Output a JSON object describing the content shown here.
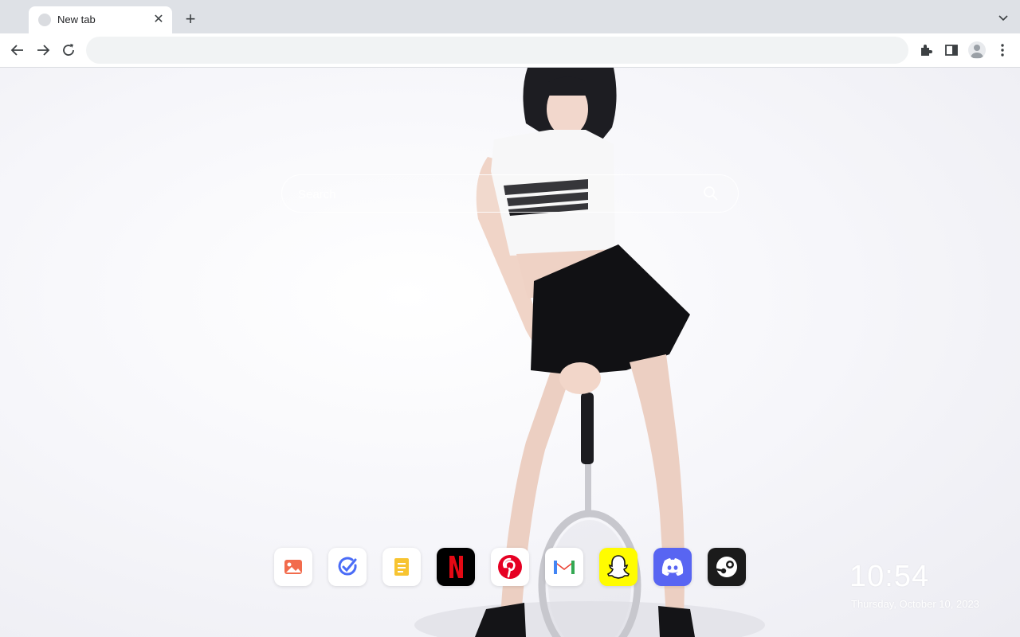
{
  "browser": {
    "tab": {
      "title": "New tab"
    },
    "omnibox": {
      "value": ""
    }
  },
  "page": {
    "search": {
      "placeholder": "Search"
    },
    "dock": [
      {
        "name": "gallery-app",
        "icon": "image-icon"
      },
      {
        "name": "todo-app",
        "icon": "check-icon"
      },
      {
        "name": "notes-app",
        "icon": "notes-icon"
      },
      {
        "name": "netflix-app",
        "icon": "netflix-icon"
      },
      {
        "name": "pinterest-app",
        "icon": "pinterest-icon"
      },
      {
        "name": "gmail-app",
        "icon": "gmail-icon"
      },
      {
        "name": "snapchat-app",
        "icon": "snapchat-icon"
      },
      {
        "name": "discord-app",
        "icon": "discord-icon"
      },
      {
        "name": "steam-app",
        "icon": "steam-icon"
      }
    ],
    "clock": {
      "time": "10:54",
      "date": "Thursday, October 10, 2023"
    }
  },
  "colors": {
    "tabstrip": "#dee1e6",
    "netflix": "#e50914",
    "pinterest": "#e60023",
    "snapchat": "#fffc00",
    "discord": "#5865f2",
    "steam": "#1b1b1b"
  }
}
